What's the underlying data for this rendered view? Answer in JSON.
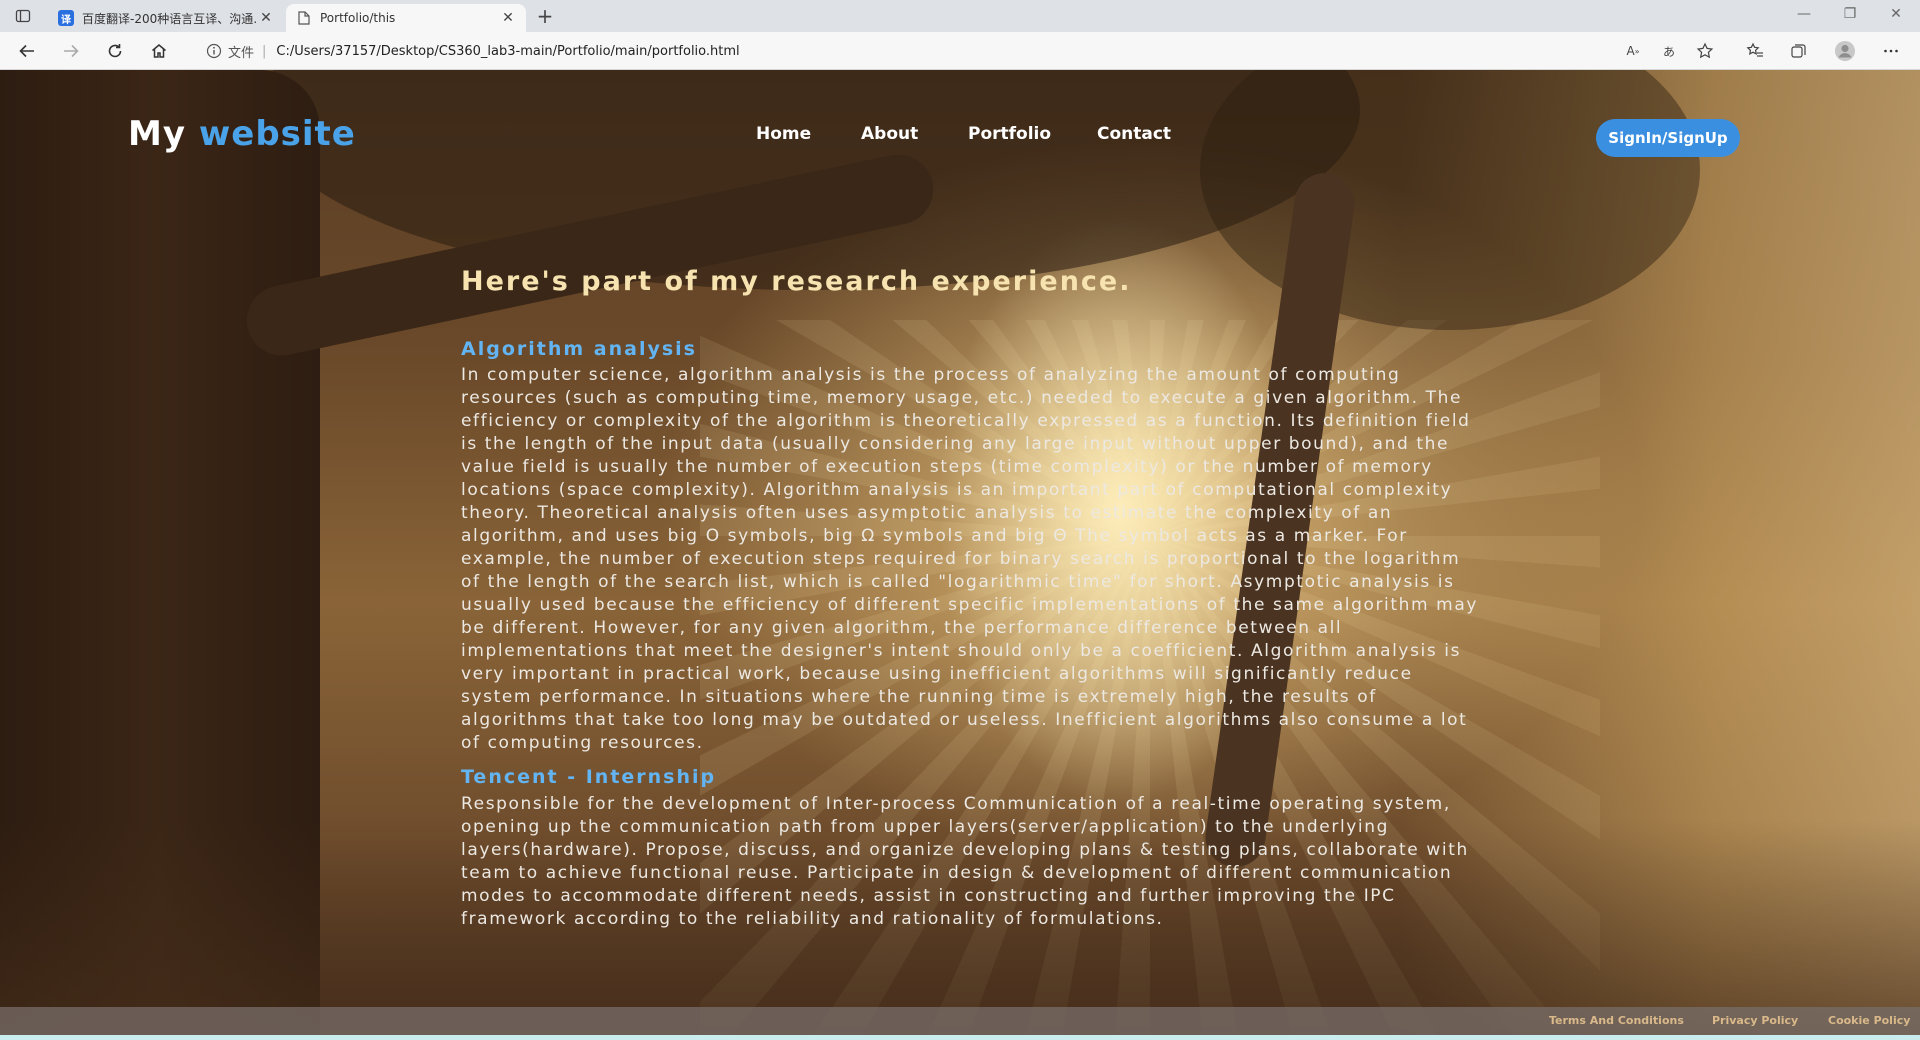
{
  "browser": {
    "tabs": [
      {
        "title": "百度翻译-200种语言互译、沟通…",
        "icon": "baidu-translate-icon",
        "active": false
      },
      {
        "title": "Portfolio/this",
        "icon": "page-icon",
        "active": true
      }
    ],
    "address": {
      "protocol_label": "文件",
      "url": "C:/Users/37157/Desktop/CS360_lab3-main/Portfolio/main/portfolio.html"
    },
    "read_aloud_label": "A",
    "translate_label": "あ"
  },
  "site": {
    "logo": {
      "part1": "My",
      "part2": "website"
    },
    "nav": [
      "Home",
      "About",
      "Portfolio",
      "Contact"
    ],
    "signin_label": "SignIn/SignUp"
  },
  "content": {
    "heading": "Here's part of my research experience.",
    "sections": [
      {
        "title": "Algorithm analysis",
        "text": "In computer science, algorithm analysis is the process of analyzing the amount of computing resources (such as computing time, memory usage, etc.) needed to execute a given algorithm. The efficiency or complexity of the algorithm is theoretically expressed as a function. Its definition field is the length of the input data (usually considering any large input without upper bound), and the value field is usually the number of execution steps (time complexity) or the number of memory locations (space complexity). Algorithm analysis is an important part of computational complexity theory. Theoretical analysis often uses asymptotic analysis to estimate the complexity of an algorithm, and uses big O symbols, big Ω symbols and big Θ The symbol acts as a marker. For example, the number of execution steps required for binary search is proportional to the logarithm of the length of the search list, which is called \"logarithmic time\" for short. Asymptotic analysis is usually used because the efficiency of different specific implementations of the same algorithm may be different. However, for any given algorithm, the performance difference between all implementations that meet the designer's intent should only be a coefficient. Algorithm analysis is very important in practical work, because using inefficient algorithms will significantly reduce system performance. In situations where the running time is extremely high, the results of algorithms that take too long may be outdated or useless. Inefficient algorithms also consume a lot of computing resources."
      },
      {
        "title": "Tencent - Internship",
        "text": "Responsible for the development of Inter-process Communication of a real-time operating system, opening up the communication path from upper layers(server/application) to the underlying layers(hardware). Propose, discuss, and organize developing plans & testing plans, collaborate with team to achieve functional reuse. Participate in design & development of different communication modes to accommodate different needs, assist in constructing and further improving the IPC framework according to the reliability and rationality of formulations."
      }
    ]
  },
  "footer": {
    "links": [
      "Terms And Conditions",
      "Privacy Policy",
      "Cookie Policy"
    ]
  },
  "colors": {
    "logo_accent": "#4aa3e8",
    "heading": "#f6e3b0",
    "section_title": "#62b4f3",
    "button": "#3b8fe0",
    "footer_link": "#d9b98a"
  }
}
